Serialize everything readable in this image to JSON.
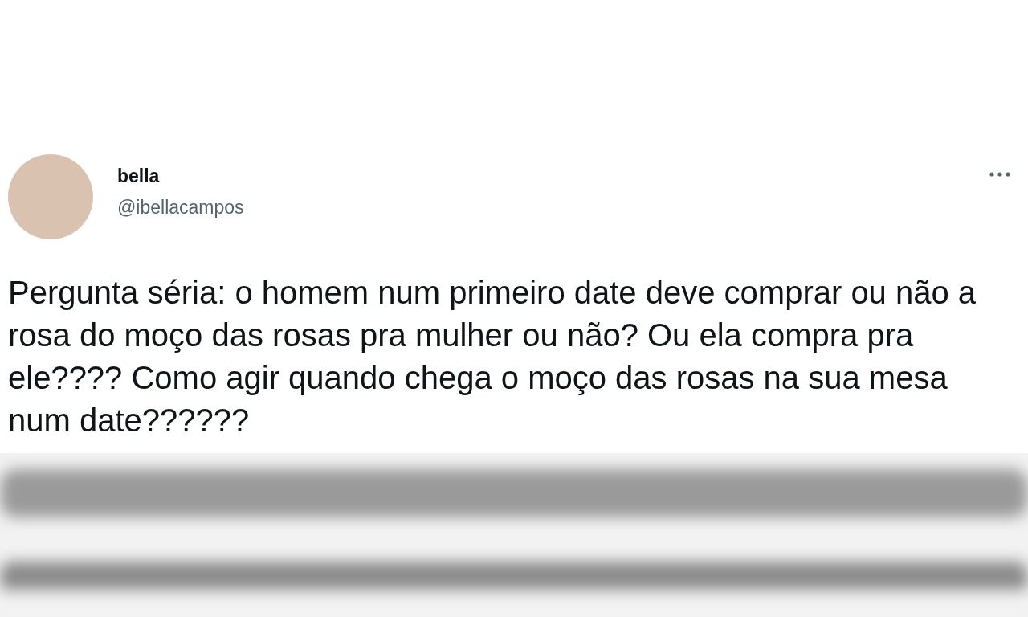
{
  "tweet": {
    "author_name": "bella",
    "author_handle": "@ibellacampos",
    "text": "Pergunta séria: o homem num primeiro date deve comprar ou não a rosa do moço das rosas pra mulher ou não? Ou ela compra pra ele???? Como agir quando chega o moço das rosas na sua mesa num date??????"
  }
}
